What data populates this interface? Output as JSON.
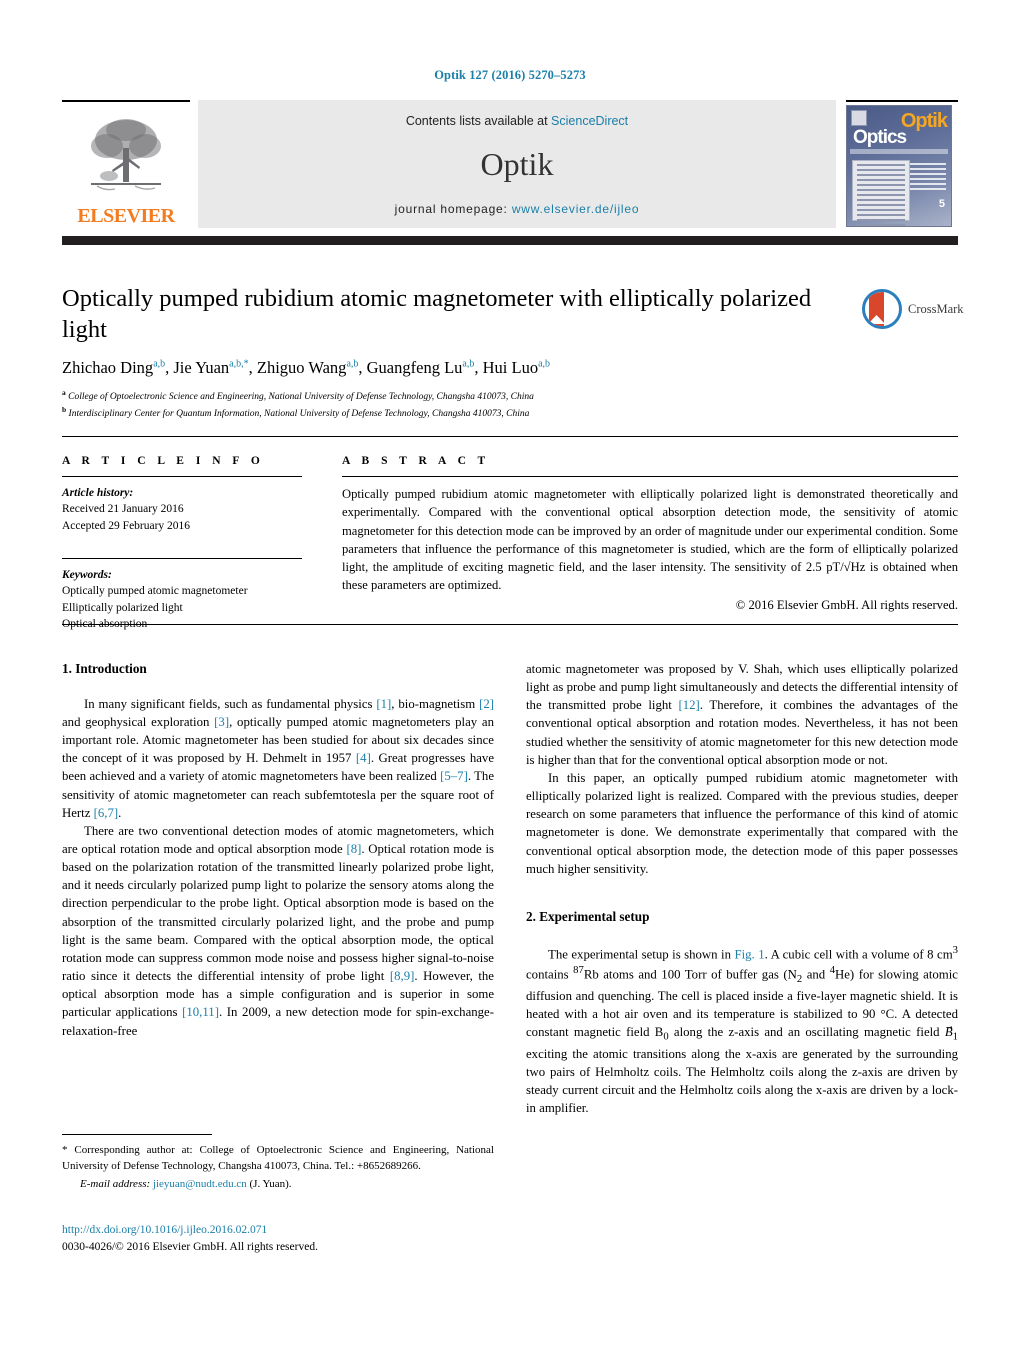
{
  "running_head": "Optik 127 (2016) 5270–5273",
  "masthead": {
    "publisher_logo_text": "ELSEVIER",
    "contents_prefix": "Contents lists available at ",
    "contents_link": "ScienceDirect",
    "journal_title": "Optik",
    "homepage_label": "journal homepage:",
    "homepage_url": "www.elsevier.de/ijleo",
    "cover": {
      "title_top": "Optik",
      "title_bottom": "Optics",
      "issue_number": "5"
    }
  },
  "article": {
    "title": "Optically pumped rubidium atomic magnetometer with elliptically polarized light",
    "crossmark_label": "CrossMark",
    "authors_html": "Zhichao Ding<sup>a,b</sup>, Jie Yuan<sup>a,b,*</sup>, Zhiguo Wang<sup>a,b</sup>, Guangfeng Lu<sup>a,b</sup>, Hui Luo<sup>a,b</sup>",
    "affiliations": [
      "a College of Optoelectronic Science and Engineering, National University of Defense Technology, Changsha 410073, China",
      "b Interdisciplinary Center for Quantum Information, National University of Defense Technology, Changsha 410073, China"
    ]
  },
  "article_info": {
    "heading": "A R T I C L E  I N F O",
    "history_label": "Article history:",
    "history": [
      "Received 21 January 2016",
      "Accepted 29 February 2016"
    ],
    "keywords_label": "Keywords:",
    "keywords": [
      "Optically pumped atomic magnetometer",
      "Elliptically polarized light",
      "Optical absorption"
    ]
  },
  "abstract": {
    "heading": "A B S T R A C T",
    "text": "Optically pumped rubidium atomic magnetometer with elliptically polarized light is demonstrated theoretically and experimentally. Compared with the conventional optical absorption detection mode, the sensitivity of atomic magnetometer for this detection mode can be improved by an order of magnitude under our experimental condition. Some parameters that influence the performance of this magnetometer is studied, which are the form of elliptically polarized light, the amplitude of exciting magnetic field, and the laser intensity. The sensitivity of 2.5 pT/√Hz is obtained when these parameters are optimized.",
    "copyright": "© 2016 Elsevier GmbH. All rights reserved."
  },
  "sections": {
    "introduction_heading": "1.  Introduction",
    "intro_p1_html": "In many significant fields, such as fundamental physics <span class=\"ref\">[1]</span>, bio-magnetism <span class=\"ref\">[2]</span> and geophysical exploration <span class=\"ref\">[3]</span>, optically pumped atomic magnetometers play an important role. Atomic magnetometer has been studied for about six decades since the concept of it was proposed by H. Dehmelt in 1957 <span class=\"ref\">[4]</span>. Great progresses have been achieved and a variety of atomic magnetometers have been realized <span class=\"ref\">[5–7]</span>. The sensitivity of atomic magnetometer can reach subfemtotesla per the square root of Hertz <span class=\"ref\">[6,7]</span>.",
    "intro_p2_html": "There are two conventional detection modes of atomic magnetometers, which are optical rotation mode and optical absorption mode <span class=\"ref\">[8]</span>. Optical rotation mode is based on the polarization rotation of the transmitted linearly polarized probe light, and it needs circularly polarized pump light to polarize the sensory atoms along the direction perpendicular to the probe light. Optical absorption mode is based on the absorption of the transmitted circularly polarized light, and the probe and pump light is the same beam. Compared with the optical absorption mode, the optical rotation mode can suppress common mode noise and possess higher signal-to-noise ratio since it detects the differential intensity of probe light <span class=\"ref\">[8,9]</span>. However, the optical absorption mode has a simple configuration and is superior in some particular applications <span class=\"ref\">[10,11]</span>. In 2009, a new detection mode for spin-exchange-relaxation-free",
    "intro_p2_cont_html": "atomic magnetometer was proposed by V. Shah, which uses elliptically polarized light as probe and pump light simultaneously and detects the differential intensity of the transmitted probe light <span class=\"ref\">[12]</span>. Therefore, it combines the advantages of the conventional optical absorption and rotation modes. Nevertheless, it has not been studied whether the sensitivity of atomic magnetometer for this new detection mode is higher than that for the conventional optical absorption mode or not.",
    "intro_p3_html": "In this paper, an optically pumped rubidium atomic magnetometer with elliptically polarized light is realized. Compared with the previous studies, deeper research on some parameters that influence the performance of this kind of atomic magnetometer is done. We demonstrate experimentally that compared with the conventional optical absorption mode, the detection mode of this paper possesses much higher sensitivity.",
    "experimental_heading": "2.  Experimental setup",
    "exp_p1_html": "The experimental setup is shown in <span class=\"lnk\">Fig. 1</span>. A cubic cell with a volume of 8 cm<sup>3</sup> contains <sup>87</sup>Rb atoms and 100 Torr of buffer gas (N<sub>2</sub> and <sup>4</sup>He) for slowing atomic diffusion and quenching. The cell is placed inside a five-layer magnetic shield. It is heated with a hot air oven and its temperature is stabilized to 90 °C. A detected constant magnetic field B<sub>0</sub> along the z-axis and an oscillating magnetic field <i>B</i>⃗<sub>1</sub> exciting the atomic transitions along the x-axis are generated by the surrounding two pairs of Helmholtz coils. The Helmholtz coils along the z-axis are driven by steady current circuit and the Helmholtz coils along the x-axis are driven by a lock-in amplifier."
  },
  "footnote": {
    "corresponding_html": "*  Corresponding author at: College of Optoelectronic Science and Engineering, National University of Defense Technology, Changsha 410073, China. Tel.: +8652689266.",
    "email_label": "E-mail address:",
    "email": "jieyuan@nudt.edu.cn",
    "email_suffix": "(J. Yuan).",
    "doi_url": "http://dx.doi.org/10.1016/j.ijleo.2016.02.071",
    "issn_line": "0030-4026/© 2016 Elsevier GmbH. All rights reserved."
  },
  "colors": {
    "link": "#1a7fa8",
    "elsevier_orange": "#F47C20",
    "bar": "#231f20"
  }
}
